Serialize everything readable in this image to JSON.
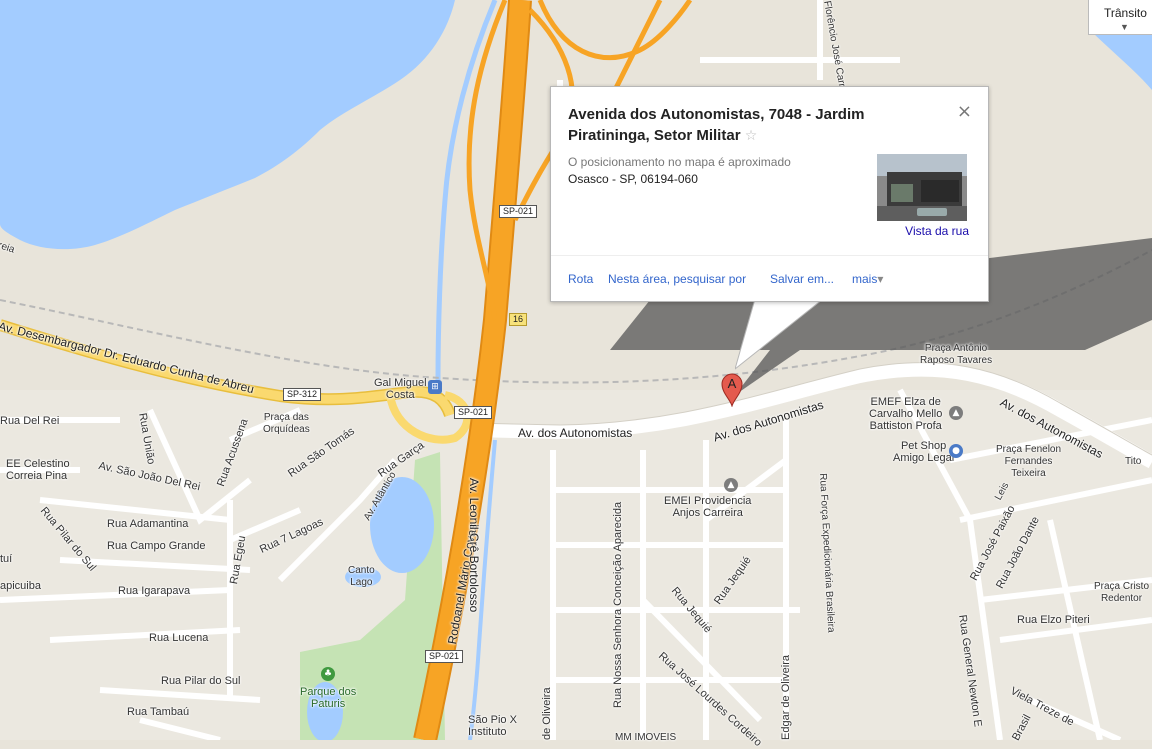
{
  "map": {
    "colors": {
      "land": "#e8e4da",
      "water": "#a3ccff",
      "park": "#c5e3b4",
      "highway": "#f7a425",
      "arterial": "#fad96f",
      "street": "#ffffff"
    },
    "labels": {
      "avenida_desembargador": "Av. Desembargador Dr. Eduardo Cunha de Abreu",
      "gal_miguel_costa": "Gal Miguel\nCosta",
      "praca_orquideas": "Praça das\nOrquídeas",
      "rua_sao_tomas": "Rua São Tomás",
      "rua_acussena": "Rua Acussena",
      "rua_uniao": "Rua União",
      "rua_do_del_rei": "Rua Del Rei",
      "ee_celestino": "EE Celestino\nCorreia Pina",
      "av_sao_joao_del_rei": "Av. São João Del Rei",
      "rua_garca": "Rua Garça",
      "av_atlantico": "Av. Atlântico",
      "rua_adamantina": "Rua Adamantina",
      "rua_pilar_do_sul_top": "Rua Pilar do Sul",
      "rua_campo_grande": "Rua Campo Grande",
      "rua_7_lagoas": "Rua 7 Lagoas",
      "rua_igarapava": "Rua Igarapava",
      "rua_egeu": "Rua Egeu",
      "rua_lucena": "Rua Lucena",
      "rua_pilar_do_sul": "Rua Pilar do Sul",
      "rua_tambau": "Rua Tambaú",
      "apicuiba": "apicuiba",
      "tui": "tuí",
      "parque_paturis": "Parque dos\nPaturis",
      "canto_lago": "Canto\nLago",
      "rodoanel": "Rodoanel Mário Covas",
      "av_leonil": "Av. Leonil Crê Bortolosso",
      "av_autonomistas_1": "Av. dos Autonomistas",
      "av_autonomistas_2": "Av. dos Autonomistas",
      "av_autonomistas_3": "Av. dos Autonomistas",
      "praca_antonio": "Praça Antônio\nRaposo Tavares",
      "emef_elza": "EMEF Elza de\nCarvalho Mello\nBattiston Profa",
      "pet_shop": "Pet Shop\nAmigo Legal",
      "praca_fenelon": "Praça Fenelon\nFernandes\nTeixeira",
      "emei_providencia": "EMEI Providencia\nAnjos Carreira",
      "rua_nossa_senhora": "Rua Nossa Senhora Conceição Aparecida",
      "rua_jequie_1": "Rua Jequié",
      "rua_jequie_2": "Rua Jequié",
      "rua_jose_lourdes": "Rua José Lourdes Cordeiro",
      "rua_forca": "Rua Força Expedicionária Brasileira",
      "edgar_de_oliveira": "Edgar de Oliveira",
      "de_oliveira": "de Oliveira",
      "rua_jose_paixao": "Rua José Paixão",
      "rua_joao_dante": "Rua João Dante",
      "praca_cristo": "Praça Cristo\nRedentor",
      "rua_elzo_piteri": "Rua Elzo Piteri",
      "rua_general_newton": "Rua General Newton E",
      "viela_treze": "Viela Treze de",
      "rua_brasil": "Brasil",
      "sao_pio": "São Pio X\nInstituto",
      "mm_imoveis": "MM IMOVEIS",
      "florencio": "Florêncio José Carneiro",
      "rua_leis": "Leis",
      "tito": "Tito",
      "ua_left": "Rua",
      "reia": "reia",
      "sp021_a": "SP-021",
      "sp021_b": "SP-021",
      "sp021_c": "SP-021",
      "sp312": "SP-312",
      "exit16": "16"
    }
  },
  "marker": {
    "label": "A"
  },
  "traffic": {
    "label": "Trânsito",
    "arrow": "▼"
  },
  "infowindow": {
    "title": "Avenida dos Autonomistas, 7048 - Jardim Piratininga, Setor Militar",
    "star": "☆",
    "close": "×",
    "note": "O posicionamento no mapa é aproximado",
    "address": "Osasco - SP, 06194-060",
    "street_view_label": "Vista da rua",
    "links": {
      "route": "Rota",
      "search_nearby": "Nesta área, pesquisar por",
      "save": "Salvar em...",
      "more": "mais",
      "more_arrow": "▾"
    }
  }
}
